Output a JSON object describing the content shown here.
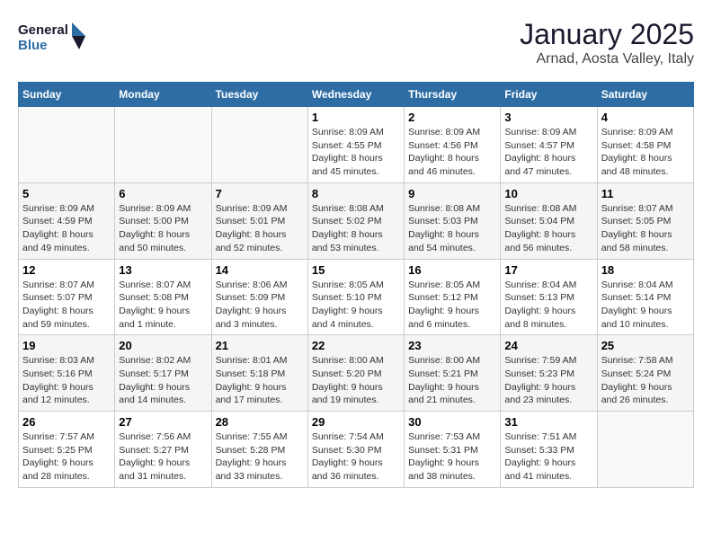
{
  "header": {
    "logo_line1": "General",
    "logo_line2": "Blue",
    "title": "January 2025",
    "subtitle": "Arnad, Aosta Valley, Italy"
  },
  "weekdays": [
    "Sunday",
    "Monday",
    "Tuesday",
    "Wednesday",
    "Thursday",
    "Friday",
    "Saturday"
  ],
  "weeks": [
    [
      {
        "num": "",
        "info": ""
      },
      {
        "num": "",
        "info": ""
      },
      {
        "num": "",
        "info": ""
      },
      {
        "num": "1",
        "info": "Sunrise: 8:09 AM\nSunset: 4:55 PM\nDaylight: 8 hours\nand 45 minutes."
      },
      {
        "num": "2",
        "info": "Sunrise: 8:09 AM\nSunset: 4:56 PM\nDaylight: 8 hours\nand 46 minutes."
      },
      {
        "num": "3",
        "info": "Sunrise: 8:09 AM\nSunset: 4:57 PM\nDaylight: 8 hours\nand 47 minutes."
      },
      {
        "num": "4",
        "info": "Sunrise: 8:09 AM\nSunset: 4:58 PM\nDaylight: 8 hours\nand 48 minutes."
      }
    ],
    [
      {
        "num": "5",
        "info": "Sunrise: 8:09 AM\nSunset: 4:59 PM\nDaylight: 8 hours\nand 49 minutes."
      },
      {
        "num": "6",
        "info": "Sunrise: 8:09 AM\nSunset: 5:00 PM\nDaylight: 8 hours\nand 50 minutes."
      },
      {
        "num": "7",
        "info": "Sunrise: 8:09 AM\nSunset: 5:01 PM\nDaylight: 8 hours\nand 52 minutes."
      },
      {
        "num": "8",
        "info": "Sunrise: 8:08 AM\nSunset: 5:02 PM\nDaylight: 8 hours\nand 53 minutes."
      },
      {
        "num": "9",
        "info": "Sunrise: 8:08 AM\nSunset: 5:03 PM\nDaylight: 8 hours\nand 54 minutes."
      },
      {
        "num": "10",
        "info": "Sunrise: 8:08 AM\nSunset: 5:04 PM\nDaylight: 8 hours\nand 56 minutes."
      },
      {
        "num": "11",
        "info": "Sunrise: 8:07 AM\nSunset: 5:05 PM\nDaylight: 8 hours\nand 58 minutes."
      }
    ],
    [
      {
        "num": "12",
        "info": "Sunrise: 8:07 AM\nSunset: 5:07 PM\nDaylight: 8 hours\nand 59 minutes."
      },
      {
        "num": "13",
        "info": "Sunrise: 8:07 AM\nSunset: 5:08 PM\nDaylight: 9 hours\nand 1 minute."
      },
      {
        "num": "14",
        "info": "Sunrise: 8:06 AM\nSunset: 5:09 PM\nDaylight: 9 hours\nand 3 minutes."
      },
      {
        "num": "15",
        "info": "Sunrise: 8:05 AM\nSunset: 5:10 PM\nDaylight: 9 hours\nand 4 minutes."
      },
      {
        "num": "16",
        "info": "Sunrise: 8:05 AM\nSunset: 5:12 PM\nDaylight: 9 hours\nand 6 minutes."
      },
      {
        "num": "17",
        "info": "Sunrise: 8:04 AM\nSunset: 5:13 PM\nDaylight: 9 hours\nand 8 minutes."
      },
      {
        "num": "18",
        "info": "Sunrise: 8:04 AM\nSunset: 5:14 PM\nDaylight: 9 hours\nand 10 minutes."
      }
    ],
    [
      {
        "num": "19",
        "info": "Sunrise: 8:03 AM\nSunset: 5:16 PM\nDaylight: 9 hours\nand 12 minutes."
      },
      {
        "num": "20",
        "info": "Sunrise: 8:02 AM\nSunset: 5:17 PM\nDaylight: 9 hours\nand 14 minutes."
      },
      {
        "num": "21",
        "info": "Sunrise: 8:01 AM\nSunset: 5:18 PM\nDaylight: 9 hours\nand 17 minutes."
      },
      {
        "num": "22",
        "info": "Sunrise: 8:00 AM\nSunset: 5:20 PM\nDaylight: 9 hours\nand 19 minutes."
      },
      {
        "num": "23",
        "info": "Sunrise: 8:00 AM\nSunset: 5:21 PM\nDaylight: 9 hours\nand 21 minutes."
      },
      {
        "num": "24",
        "info": "Sunrise: 7:59 AM\nSunset: 5:23 PM\nDaylight: 9 hours\nand 23 minutes."
      },
      {
        "num": "25",
        "info": "Sunrise: 7:58 AM\nSunset: 5:24 PM\nDaylight: 9 hours\nand 26 minutes."
      }
    ],
    [
      {
        "num": "26",
        "info": "Sunrise: 7:57 AM\nSunset: 5:25 PM\nDaylight: 9 hours\nand 28 minutes."
      },
      {
        "num": "27",
        "info": "Sunrise: 7:56 AM\nSunset: 5:27 PM\nDaylight: 9 hours\nand 31 minutes."
      },
      {
        "num": "28",
        "info": "Sunrise: 7:55 AM\nSunset: 5:28 PM\nDaylight: 9 hours\nand 33 minutes."
      },
      {
        "num": "29",
        "info": "Sunrise: 7:54 AM\nSunset: 5:30 PM\nDaylight: 9 hours\nand 36 minutes."
      },
      {
        "num": "30",
        "info": "Sunrise: 7:53 AM\nSunset: 5:31 PM\nDaylight: 9 hours\nand 38 minutes."
      },
      {
        "num": "31",
        "info": "Sunrise: 7:51 AM\nSunset: 5:33 PM\nDaylight: 9 hours\nand 41 minutes."
      },
      {
        "num": "",
        "info": ""
      }
    ]
  ]
}
